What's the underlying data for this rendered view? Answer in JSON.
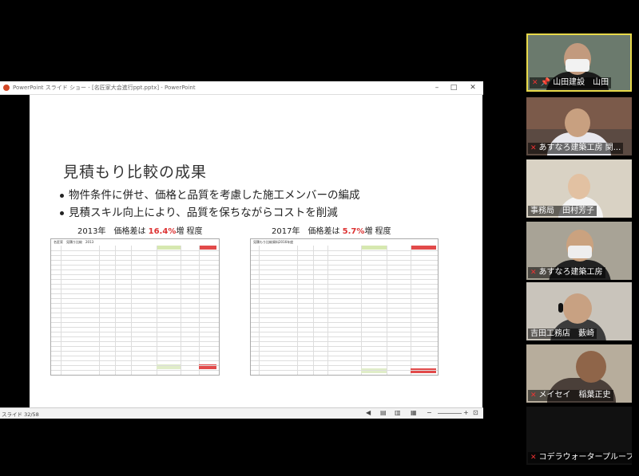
{
  "ppt": {
    "title": "PowerPoint スライド ショー - [名匠家大会進行ppt.pptx] - PowerPoint",
    "slide_counter": "スライド 32/58",
    "slide": {
      "heading": "見積もり比較の成果",
      "bullets": [
        "物件条件に併せ、価格と品質を考慮した施工メンバーの編成",
        "見積スキル向上により、品質を保ちながらコストを削減"
      ],
      "left_caption": {
        "prefix": "2013年　価格差は ",
        "value": "16.4%",
        "suffix": "増 程度"
      },
      "right_caption": {
        "prefix": "2017年　価格差は ",
        "value": "5.7%",
        "suffix": "増 程度"
      },
      "left_table_title": "名匠家　見積り比較　2013",
      "right_table_title": "見積もり比較資料2016年度"
    }
  },
  "participants": [
    {
      "name": "山田建設　山田",
      "active": true,
      "pinned": true
    },
    {
      "name": "あすなろ建築工房 関...",
      "active": false
    },
    {
      "name": "事務局　田村芳子",
      "active": false
    },
    {
      "name": "あすなろ建築工房",
      "active": false
    },
    {
      "name": "吉田工務店　藪崎",
      "active": false
    },
    {
      "name": "メイセイ　稲葉正史",
      "active": false
    },
    {
      "name": "コデラウォータープルーフ",
      "active": false
    }
  ],
  "colors": {
    "accent_red": "#d33333",
    "active_border": "#e8d94a"
  }
}
